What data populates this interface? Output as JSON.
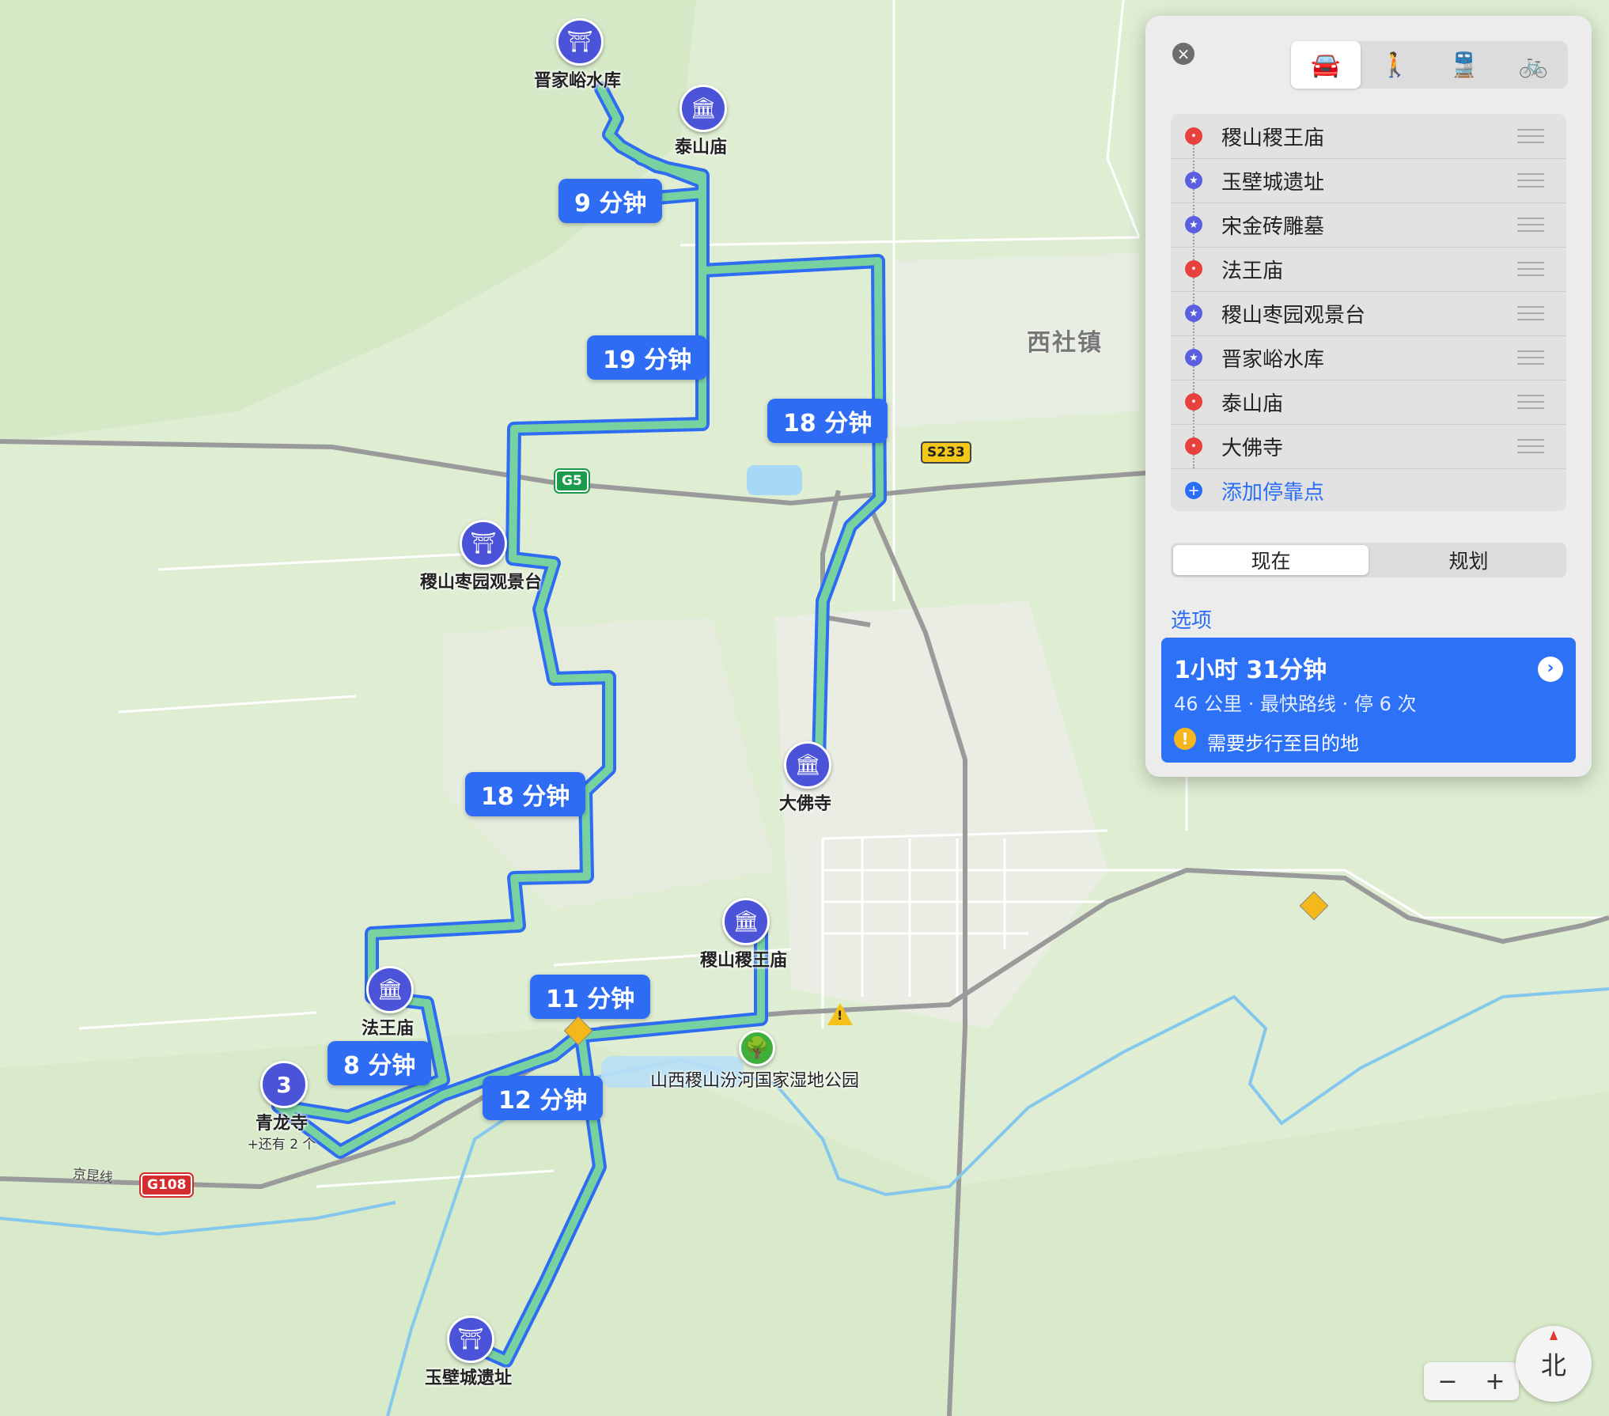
{
  "map": {
    "durations": {
      "d1": "9 分钟",
      "d2": "19 分钟",
      "d3": "18 分钟",
      "d4": "18 分钟",
      "d5": "11 分钟",
      "d6": "8 分钟",
      "d7": "12 分钟"
    },
    "pois": {
      "jinjiayu": "晋家峪水库",
      "taishan": "泰山庙",
      "zaoyuan": "稷山枣园观景台",
      "dafo": "大佛寺",
      "jiwang": "稷山稷王庙",
      "fawang": "法王庙",
      "qinglong": "青龙寺",
      "qinglong_more": "+还有 2 个",
      "qinglong_badge": "3",
      "yubi": "玉壁城遗址",
      "park": "山西稷山汾河国家湿地公园"
    },
    "town": "西社镇",
    "shields": {
      "g5": "G5",
      "s233": "S233",
      "g108": "G108"
    },
    "rail_label": "京昆线"
  },
  "panel": {
    "close_icon": "×",
    "modes": [
      {
        "name": "driving",
        "icon": "🚘",
        "active": true
      },
      {
        "name": "walking",
        "icon": "🚶",
        "active": false
      },
      {
        "name": "transit",
        "icon": "🚆",
        "active": false
      },
      {
        "name": "cycling",
        "icon": "🚲",
        "active": false
      }
    ],
    "stops": [
      {
        "label": "稷山稷王庙",
        "type": "red"
      },
      {
        "label": "玉壁城遗址",
        "type": "blue"
      },
      {
        "label": "宋金砖雕墓",
        "type": "blue"
      },
      {
        "label": "法王庙",
        "type": "red"
      },
      {
        "label": "稷山枣园观景台",
        "type": "blue"
      },
      {
        "label": "晋家峪水库",
        "type": "blue"
      },
      {
        "label": "泰山庙",
        "type": "red"
      },
      {
        "label": "大佛寺",
        "type": "red"
      }
    ],
    "add_stop": "添加停靠点",
    "segment": {
      "now": "现在",
      "plan": "规划"
    },
    "options": "选项",
    "route": {
      "time": "1小时 31分钟",
      "meta": "46 公里 · 最快路线 · 停 6 次",
      "alert": "需要步行至目的地",
      "alert_icon": "!"
    }
  },
  "controls": {
    "zoom_out": "−",
    "zoom_in": "+",
    "compass": "北"
  }
}
